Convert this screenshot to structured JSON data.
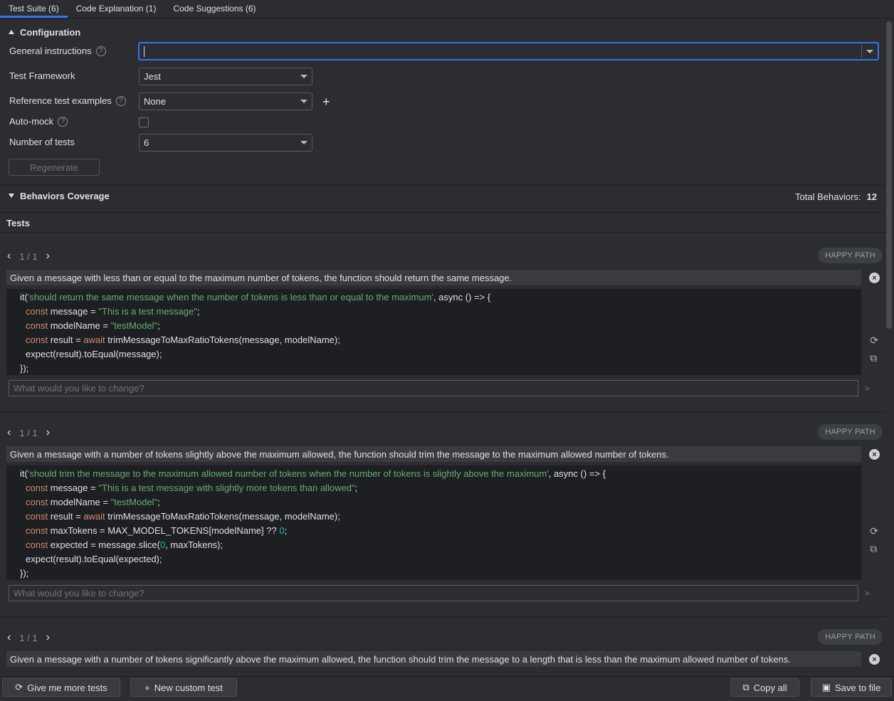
{
  "tabs": [
    {
      "label": "Test Suite (6)"
    },
    {
      "label": "Code Explanation (1)"
    },
    {
      "label": "Code Suggestions (6)"
    }
  ],
  "configuration": {
    "title": "Configuration",
    "general_instructions_label": "General instructions",
    "general_instructions_value": "",
    "test_framework_label": "Test Framework",
    "test_framework_value": "Jest",
    "reference_examples_label": "Reference test examples",
    "reference_examples_value": "None",
    "auto_mock_label": "Auto-mock",
    "auto_mock_checked": false,
    "number_of_tests_label": "Number of tests",
    "number_of_tests_value": "6",
    "regenerate_label": "Regenerate"
  },
  "behaviors": {
    "title": "Behaviors Coverage",
    "total_label": "Total Behaviors:",
    "total_value": "12"
  },
  "tests_title": "Tests",
  "tests": [
    {
      "pager": "1 / 1",
      "badge": "HAPPY PATH",
      "description": "Given a message with less than or equal to the maximum number of tokens, the function should return the same message.",
      "change_placeholder": "What would you like to change?"
    },
    {
      "pager": "1 / 1",
      "badge": "HAPPY PATH",
      "description": "Given a message with a number of tokens slightly above the maximum allowed, the function should trim the message to the maximum allowed number of tokens.",
      "change_placeholder": "What would you like to change?"
    },
    {
      "pager": "1 / 1",
      "badge": "HAPPY PATH",
      "description": "Given a message with a number of tokens significantly above the maximum allowed, the function should trim the message to a length that is less than the maximum allowed number of tokens.",
      "change_placeholder": ""
    }
  ],
  "code1": {
    "l1_a": "it(",
    "l1_s": "'should return the same message when the number of tokens is less than or equal to the maximum'",
    "l1_b": ", async () => {",
    "l2_kw": "const",
    "l2_a": " message = ",
    "l2_s": "\"This is a test message\"",
    "l2_b": ";",
    "l3_kw": "const",
    "l3_a": " modelName = ",
    "l3_s": "\"testModel\"",
    "l3_b": ";",
    "l4_kw": "const",
    "l4_a": " result = ",
    "l4_kw2": "await",
    "l4_b": " trimMessageToMaxRatioTokens(message, modelName);",
    "l5": "expect(result).toEqual(message);",
    "l6": "});"
  },
  "code2": {
    "l1_a": "it(",
    "l1_s": "'should trim the message to the maximum allowed number of tokens when the number of tokens is slightly above the maximum'",
    "l1_b": ", async () => {",
    "l2_kw": "const",
    "l2_a": " message = ",
    "l2_s": "\"This is a test message with slightly more tokens than allowed\"",
    "l2_b": ";",
    "l3_kw": "const",
    "l3_a": " modelName = ",
    "l3_s": "\"testModel\"",
    "l3_b": ";",
    "l4_kw": "const",
    "l4_a": " result = ",
    "l4_kw2": "await",
    "l4_b": " trimMessageToMaxRatioTokens(message, modelName);",
    "l5_kw": "const",
    "l5_a": " maxTokens = MAX_MODEL_TOKENS[modelName] ?? ",
    "l5_n": "0",
    "l5_b": ";",
    "l6_kw": "const",
    "l6_a": " expected = message.slice(",
    "l6_n": "0",
    "l6_b": ", maxTokens);",
    "l7": "expect(result).toEqual(expected);",
    "l8": "});"
  },
  "bottom": {
    "more_tests": "Give me more tests",
    "custom_test": "New custom test",
    "copy_all": "Copy all",
    "save_file": "Save to file"
  },
  "icons": {
    "regenerate": "refresh-icon",
    "copy": "copy-icon",
    "close": "close-icon",
    "send": "send-icon",
    "save": "save-icon",
    "plus": "plus-icon"
  }
}
